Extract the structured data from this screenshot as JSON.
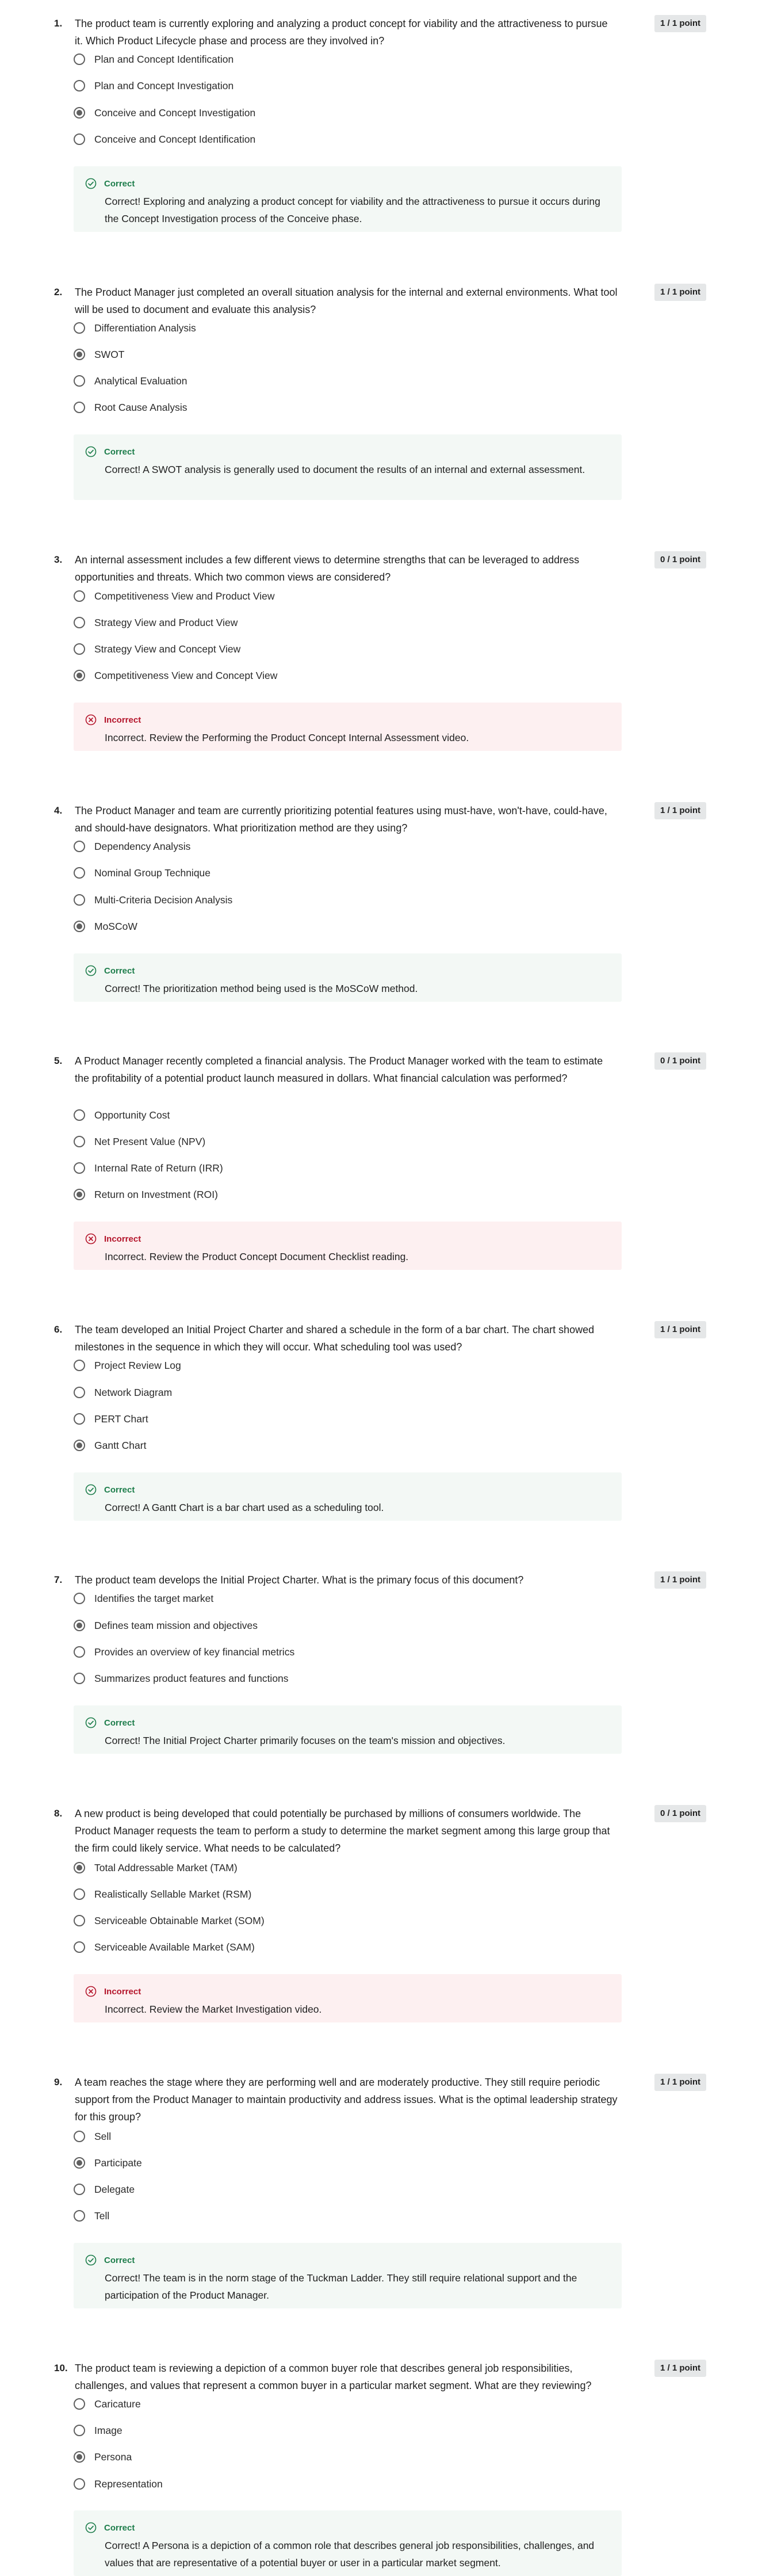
{
  "colors": {
    "correct": "#1d7d4b",
    "incorrect": "#b4152b",
    "correct_bg": "#f3f8f5",
    "incorrect_bg": "#fdf0f1"
  },
  "icons": {
    "correct": "check-circle-icon",
    "incorrect": "x-circle-icon"
  },
  "questions": [
    {
      "number": "1.",
      "text": "The product team is currently exploring and analyzing a product concept for viability and the attractiveness to pursue it. Which Product Lifecycle phase and process are they involved in?",
      "points": "1 / 1 point",
      "options": [
        "Plan and Concept Identification",
        "Plan and Concept Investigation",
        "Conceive and Concept Investigation",
        "Conceive and Concept Identification"
      ],
      "selected": 2,
      "correct": true,
      "feedback_status": "Correct",
      "feedback_text": "Correct! Exploring and analyzing a product concept for viability and the attractiveness to pursue it occurs during the Concept Investigation process of the Conceive phase."
    },
    {
      "number": "2.",
      "text": "The Product Manager just completed an overall situation analysis for the internal and external environments. What tool will be used to document and evaluate this analysis?",
      "points": "1 / 1 point",
      "options": [
        "Differentiation Analysis",
        "SWOT",
        "Analytical Evaluation",
        "Root Cause Analysis"
      ],
      "selected": 1,
      "correct": true,
      "feedback_status": "Correct",
      "feedback_text": "Correct! A SWOT analysis is generally used to document the results of an internal and external assessment."
    },
    {
      "number": "3.",
      "text": "An internal assessment includes a few different views to determine strengths that can be leveraged to address opportunities and threats. Which two common views are considered?",
      "points": "0 / 1 point",
      "options": [
        "Competitiveness View and Product View",
        "Strategy View and Product View",
        "Strategy View and Concept View",
        "Competitiveness View and Concept View"
      ],
      "selected": 3,
      "correct": false,
      "feedback_status": "Incorrect",
      "feedback_text": "Incorrect. Review the Performing the Product Concept Internal Assessment video."
    },
    {
      "number": "4.",
      "text": "The Product Manager and team are currently prioritizing potential features using must-have, won't-have, could-have, and should-have designators. What prioritization method are they using?",
      "points": "1 / 1 point",
      "options": [
        "Dependency Analysis",
        "Nominal Group Technique",
        "Multi-Criteria Decision Analysis",
        "MoSCoW"
      ],
      "selected": 3,
      "correct": true,
      "feedback_status": "Correct",
      "feedback_text": "Correct! The prioritization method being used is the MoSCoW method."
    },
    {
      "number": "5.",
      "text": "A Product Manager recently completed a financial analysis. The Product Manager worked with the team to estimate the profitability of a potential product launch measured in dollars. What financial calculation was performed?",
      "points": "0 / 1 point",
      "options": [
        "Opportunity Cost",
        "Net Present Value (NPV)",
        "Internal Rate of Return (IRR)",
        "Return on Investment (ROI)"
      ],
      "selected": 3,
      "correct": false,
      "feedback_status": "Incorrect",
      "feedback_text": "Incorrect. Review the Product Concept Document Checklist reading."
    },
    {
      "number": "6.",
      "text": "The team developed an Initial Project Charter and shared a schedule in the form of a bar chart. The chart showed milestones in the sequence in which they will occur. What scheduling tool was used?",
      "points": "1 / 1 point",
      "options": [
        "Project Review Log",
        "Network Diagram",
        "PERT Chart",
        "Gantt Chart"
      ],
      "selected": 3,
      "correct": true,
      "feedback_status": "Correct",
      "feedback_text": "Correct! A Gantt Chart is a bar chart used as a scheduling tool."
    },
    {
      "number": "7.",
      "text": "The product team develops the Initial Project Charter. What is the primary focus of this document?",
      "points": "1 / 1 point",
      "options": [
        "Identifies the target market",
        "Defines team mission and objectives",
        "Provides an overview of key financial metrics",
        "Summarizes product features and functions"
      ],
      "selected": 1,
      "correct": true,
      "feedback_status": "Correct",
      "feedback_text": "Correct! The Initial Project Charter primarily focuses on the team's mission and objectives."
    },
    {
      "number": "8.",
      "text": "A new product is being developed that could potentially be purchased by millions of consumers worldwide. The Product Manager requests the team to perform a study to determine the market segment among this large group that the firm could likely service. What needs to be calculated?",
      "points": "0 / 1 point",
      "options": [
        "Total Addressable Market (TAM)",
        "Realistically Sellable Market (RSM)",
        "Serviceable Obtainable Market (SOM)",
        "Serviceable Available Market (SAM)"
      ],
      "selected": 0,
      "correct": false,
      "feedback_status": "Incorrect",
      "feedback_text": "Incorrect. Review the Market Investigation video."
    },
    {
      "number": "9.",
      "text": "A team reaches the stage where they are performing well and are moderately productive. They still require periodic support from the Product Manager to maintain productivity and address issues. What is the optimal leadership strategy for this group?",
      "points": "1 / 1 point",
      "options": [
        "Sell",
        "Participate",
        "Delegate",
        "Tell"
      ],
      "selected": 1,
      "correct": true,
      "feedback_status": "Correct",
      "feedback_text": "Correct! The team is in the norm stage of the Tuckman Ladder. They still require relational support and the participation of the Product Manager."
    },
    {
      "number": "10.",
      "text": "The product team is reviewing a depiction of a common buyer role that describes general job responsibilities, challenges, and values that represent a common buyer in a particular market segment. What are they reviewing?",
      "points": "1 / 1 point",
      "options": [
        "Caricature",
        "Image",
        "Persona",
        "Representation"
      ],
      "selected": 2,
      "correct": true,
      "feedback_status": "Correct",
      "feedback_text": "Correct! A Persona is a depiction of a common role that describes general job responsibilities, challenges, and values that are representative of a potential buyer or user in a particular market segment."
    }
  ]
}
